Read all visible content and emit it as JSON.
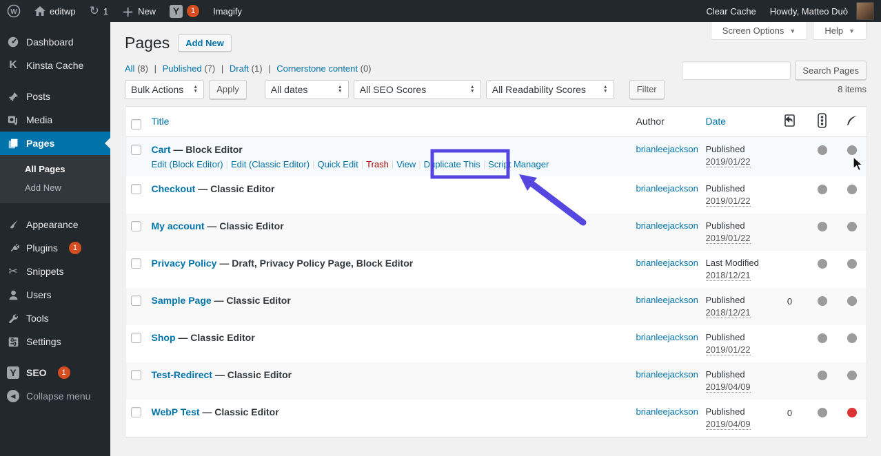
{
  "colors": {
    "accent": "#0073aa",
    "annotation_purple": "#5646e0",
    "dot_gray": "#9b9b9b",
    "dot_red": "#dc3232",
    "badge_red": "#d54e21",
    "admin_dark": "#23282d"
  },
  "admin_bar": {
    "site_name": "editwp",
    "updates_count": "1",
    "new_label": "New",
    "yoast_count": "1",
    "imagify_label": "Imagify",
    "clear_cache_label": "Clear Cache",
    "howdy": "Howdy, Matteo Duò",
    "icons": [
      "wordpress-logo",
      "home-icon",
      "updates-icon",
      "plus-icon",
      "yoast-icon",
      "avatar"
    ]
  },
  "screen_meta": {
    "screen_options": "Screen Options",
    "help": "Help"
  },
  "sidebar": {
    "items": [
      {
        "icon": "dashboard-icon",
        "label": "Dashboard"
      },
      {
        "icon": "kinsta-icon",
        "label": "Kinsta Cache"
      },
      {
        "icon": "pin-icon",
        "label": "Posts"
      },
      {
        "icon": "media-icon",
        "label": "Media"
      },
      {
        "icon": "pages-icon",
        "label": "Pages",
        "active": true
      },
      {
        "icon": "brush-icon",
        "label": "Appearance"
      },
      {
        "icon": "plugin-icon",
        "label": "Plugins",
        "badge": "1"
      },
      {
        "icon": "scissors-icon",
        "label": "Snippets"
      },
      {
        "icon": "user-icon",
        "label": "Users"
      },
      {
        "icon": "wrench-icon",
        "label": "Tools"
      },
      {
        "icon": "settings-icon",
        "label": "Settings"
      },
      {
        "icon": "yoast-icon",
        "label": "SEO",
        "badge": "1"
      }
    ],
    "submenu": {
      "items": [
        {
          "label": "All Pages",
          "current": true
        },
        {
          "label": "Add New"
        }
      ]
    },
    "collapse_label": "Collapse menu"
  },
  "page": {
    "title": "Pages",
    "add_new_label": "Add New"
  },
  "views": {
    "items": [
      {
        "label": "All",
        "count": "(8)"
      },
      {
        "label": "Published",
        "count": "(7)"
      },
      {
        "label": "Draft",
        "count": "(1)"
      },
      {
        "label": "Cornerstone content",
        "count": "(0)"
      }
    ]
  },
  "toolbar": {
    "bulk_actions": "Bulk Actions",
    "apply_label": "Apply",
    "all_dates": "All dates",
    "all_seo_scores": "All SEO Scores",
    "all_readability_scores": "All Readability Scores",
    "filter_label": "Filter",
    "items_count": "8 items"
  },
  "search": {
    "value": "",
    "placeholder": "",
    "button_label": "Search Pages"
  },
  "table": {
    "headers": {
      "title": "Title",
      "author": "Author",
      "date": "Date"
    },
    "header_icons": [
      "script-manager-icon",
      "seo-score-icon",
      "readability-icon"
    ]
  },
  "rows": [
    {
      "title": "Cart",
      "subtitle": "— Block Editor",
      "author": "brianleejackson",
      "status": "Published",
      "date": "2019/01/22",
      "script_count": "",
      "seo_dot": "gray",
      "readability_dot": "gray",
      "actions": [
        {
          "label": "Edit (Block Editor)"
        },
        {
          "label": "Edit (Classic Editor)"
        },
        {
          "label": "Quick Edit"
        },
        {
          "label": "Trash"
        },
        {
          "label": "View"
        },
        {
          "label": "Duplicate This"
        },
        {
          "label": "Script Manager"
        }
      ]
    },
    {
      "title": "Checkout",
      "subtitle": "— Classic Editor",
      "author": "brianleejackson",
      "status": "Published",
      "date": "2019/01/22",
      "script_count": "",
      "seo_dot": "gray",
      "readability_dot": "gray"
    },
    {
      "title": "My account",
      "subtitle": "— Classic Editor",
      "author": "brianleejackson",
      "status": "Published",
      "date": "2019/01/22",
      "script_count": "",
      "seo_dot": "gray",
      "readability_dot": "gray"
    },
    {
      "title": "Privacy Policy",
      "subtitle": "— Draft, Privacy Policy Page, Block Editor",
      "author": "brianleejackson",
      "status": "Last Modified",
      "date": "2018/12/21",
      "script_count": "",
      "seo_dot": "gray",
      "readability_dot": "gray"
    },
    {
      "title": "Sample Page",
      "subtitle": "— Classic Editor",
      "author": "brianleejackson",
      "status": "Published",
      "date": "2018/12/21",
      "script_count": "0",
      "seo_dot": "gray",
      "readability_dot": "gray"
    },
    {
      "title": "Shop",
      "subtitle": "— Classic Editor",
      "author": "brianleejackson",
      "status": "Published",
      "date": "2019/01/22",
      "script_count": "",
      "seo_dot": "gray",
      "readability_dot": "gray"
    },
    {
      "title": "Test-Redirect",
      "subtitle": "— Classic Editor",
      "author": "brianleejackson",
      "status": "Published",
      "date": "2019/04/09",
      "script_count": "",
      "seo_dot": "gray",
      "readability_dot": "gray"
    },
    {
      "title": "WebP Test",
      "subtitle": "— Classic Editor",
      "author": "brianleejackson",
      "status": "Published",
      "date": "2019/04/09",
      "script_count": "0",
      "seo_dot": "gray",
      "readability_dot": "red"
    }
  ],
  "annotation": {
    "highlighted_action": "Duplicate This"
  }
}
